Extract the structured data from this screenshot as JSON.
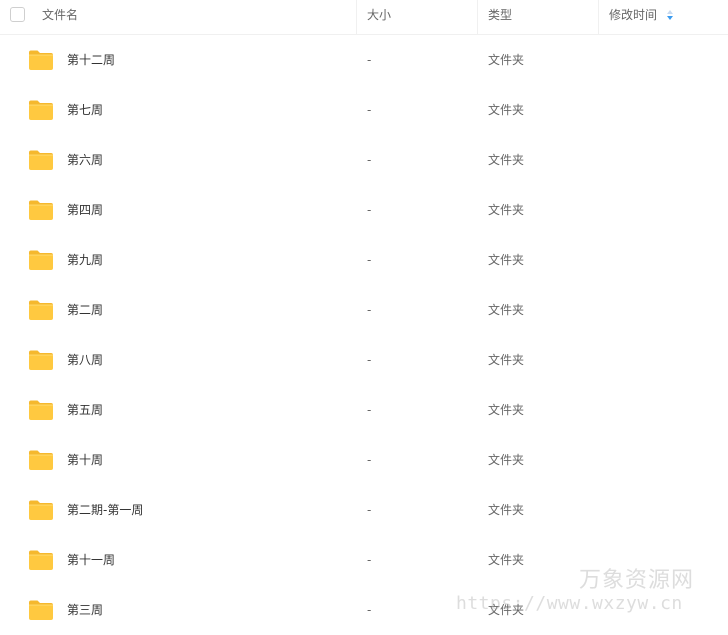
{
  "header": {
    "name_label": "文件名",
    "size_label": "大小",
    "type_label": "类型",
    "modified_label": "修改时间"
  },
  "files": [
    {
      "name": "第十二周",
      "size": "-",
      "type": "文件夹"
    },
    {
      "name": "第七周",
      "size": "-",
      "type": "文件夹"
    },
    {
      "name": "第六周",
      "size": "-",
      "type": "文件夹"
    },
    {
      "name": "第四周",
      "size": "-",
      "type": "文件夹"
    },
    {
      "name": "第九周",
      "size": "-",
      "type": "文件夹"
    },
    {
      "name": "第二周",
      "size": "-",
      "type": "文件夹"
    },
    {
      "name": "第八周",
      "size": "-",
      "type": "文件夹"
    },
    {
      "name": "第五周",
      "size": "-",
      "type": "文件夹"
    },
    {
      "name": "第十周",
      "size": "-",
      "type": "文件夹"
    },
    {
      "name": "第二期-第一周",
      "size": "-",
      "type": "文件夹"
    },
    {
      "name": "第十一周",
      "size": "-",
      "type": "文件夹"
    },
    {
      "name": "第三周",
      "size": "-",
      "type": "文件夹"
    }
  ],
  "watermark": {
    "title": "万象资源网",
    "url": "https://www.wxzyw.cn"
  },
  "colors": {
    "folder": "#FFC940",
    "folder_tab": "#F5B82E",
    "sort_icon": "#3A9BF0"
  },
  "icons": {
    "folder": "folder-icon",
    "sort": "sort-icon",
    "checkbox": "checkbox"
  }
}
